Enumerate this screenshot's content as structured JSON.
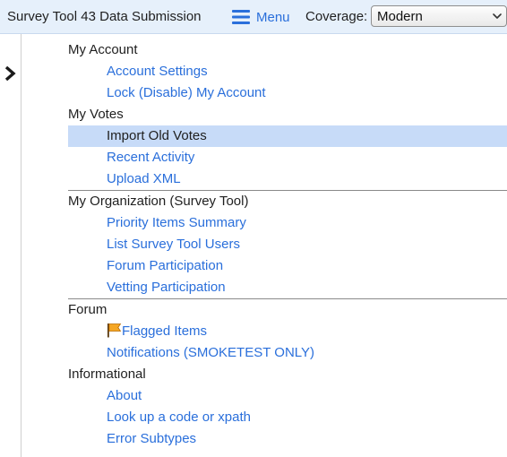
{
  "header": {
    "title": "Survey Tool 43 Data Submission",
    "menu_label": "Menu",
    "coverage_label": "Coverage:",
    "coverage_value": "Modern"
  },
  "sections": [
    {
      "title": "My Account",
      "items": [
        "Account Settings",
        "Lock (Disable) My Account"
      ]
    },
    {
      "title": "My Votes",
      "items": [
        "Import Old Votes",
        "Recent Activity",
        "Upload XML"
      ]
    },
    {
      "title": "My Organization (Survey Tool)",
      "items": [
        "Priority Items Summary",
        "List Survey Tool Users",
        "Forum Participation",
        "Vetting Participation"
      ]
    },
    {
      "title": "Forum",
      "items": [
        "Flagged Items",
        "Notifications (SMOKETEST ONLY)"
      ]
    },
    {
      "title": "Informational",
      "items": [
        "About",
        "Look up a code or xpath",
        "Error Subtypes"
      ]
    }
  ],
  "selected_item": "Import Old Votes",
  "icons": {
    "menu_toggle": "hamburger-icon",
    "coverage_dropdown": "chevron-down-icon",
    "sidebar_toggle": "chevron-right-icon",
    "flagged_items": "flag-icon"
  },
  "colors": {
    "topbar_bg": "#e6f0fb",
    "link": "#2a6fdb",
    "selected_bg": "#c7dbf8",
    "flag": "#f5a623"
  }
}
